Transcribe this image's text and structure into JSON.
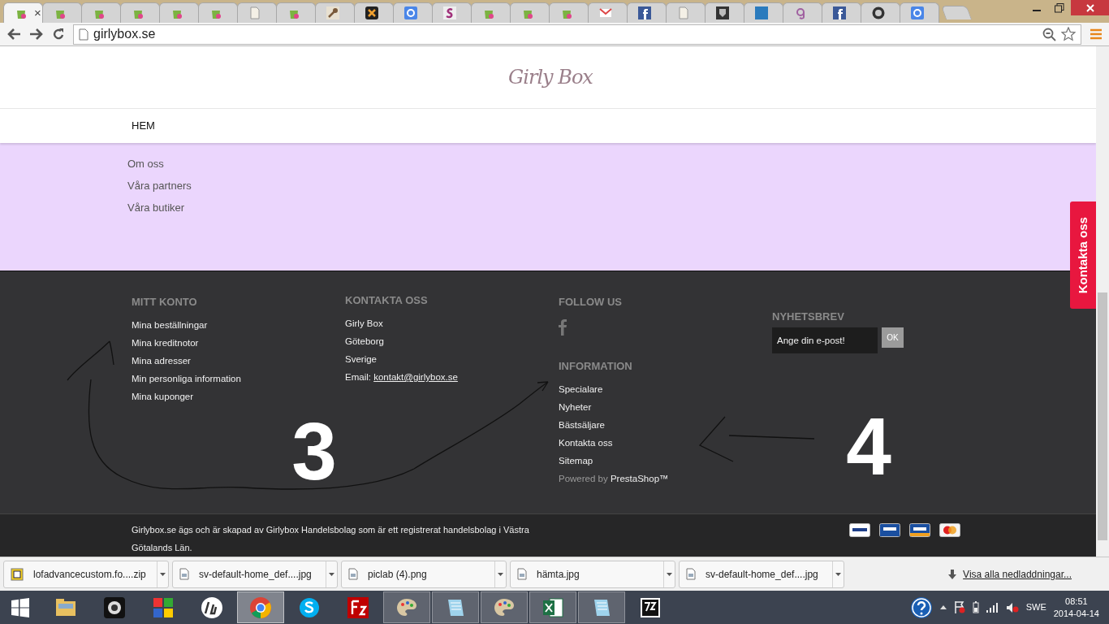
{
  "browser": {
    "tabs": [
      {
        "kind": "shop",
        "selected": true,
        "close": "×"
      },
      {
        "kind": "shop",
        "selected": false
      },
      {
        "kind": "shop",
        "selected": false
      },
      {
        "kind": "shop",
        "selected": false
      },
      {
        "kind": "shop",
        "selected": false
      },
      {
        "kind": "shop",
        "selected": false
      },
      {
        "kind": "page",
        "selected": false
      },
      {
        "kind": "shop",
        "selected": false
      },
      {
        "kind": "wrench",
        "selected": false
      },
      {
        "kind": "joomla",
        "selected": false
      },
      {
        "kind": "google",
        "selected": false
      },
      {
        "kind": "s",
        "selected": false
      },
      {
        "kind": "shop",
        "selected": false
      },
      {
        "kind": "shop",
        "selected": false
      },
      {
        "kind": "shop",
        "selected": false
      },
      {
        "kind": "mail",
        "selected": false
      },
      {
        "kind": "facebook",
        "selected": false
      },
      {
        "kind": "page",
        "selected": false
      },
      {
        "kind": "shield",
        "selected": false
      },
      {
        "kind": "square",
        "selected": false
      },
      {
        "kind": "g",
        "selected": false
      },
      {
        "kind": "facebook",
        "selected": false
      },
      {
        "kind": "seal",
        "selected": false
      },
      {
        "kind": "google",
        "selected": false
      }
    ],
    "address": "girlybox.se"
  },
  "page": {
    "logo": "Girly Box",
    "nav": [
      {
        "label": "HEM"
      }
    ],
    "info_links": [
      "Om oss",
      "Våra partners",
      "Våra butiker"
    ],
    "side_tab": "Kontakta oss",
    "footer": {
      "account": {
        "heading": "MITT KONTO",
        "links": [
          "Mina beställningar",
          "Mina kreditnotor",
          "Mina adresser",
          "Min personliga information",
          "Mina kuponger"
        ]
      },
      "contact": {
        "heading": "KONTAKTA OSS",
        "lines": [
          "Girly Box",
          "Göteborg",
          "Sverige"
        ],
        "email_label": "Email:",
        "email": "kontakt@girlybox.se"
      },
      "follow": {
        "heading": "FOLLOW US"
      },
      "information": {
        "heading": "INFORMATION",
        "links": [
          "Specialare",
          "Nyheter",
          "Bästsäljare",
          "Kontakta oss",
          "Sitemap"
        ],
        "powered_by": "Powered by",
        "powered_brand": "PrestaShop™"
      },
      "newsletter": {
        "heading": "NYHETSBREV",
        "placeholder": "Ange din e-post!",
        "button": "OK"
      }
    },
    "legal": "Girlybox.se ägs och är skapad av Girlybox Handelsbolag som är ett registrerat handelsbolag i Västra Götalands Län.",
    "payments": [
      {
        "kind": "paypal"
      },
      {
        "kind": "visa"
      },
      {
        "kind": "visa"
      },
      {
        "kind": "mastercard"
      }
    ],
    "annotations": [
      {
        "label": "3"
      },
      {
        "label": "4"
      }
    ]
  },
  "downloads": {
    "items": [
      {
        "name": "lofadvancecustom.fo....zip",
        "kind": "zip"
      },
      {
        "name": "sv-default-home_def....jpg",
        "kind": "file"
      },
      {
        "name": "piclab (4).png",
        "kind": "file"
      },
      {
        "name": "hämta.jpg",
        "kind": "file"
      },
      {
        "name": "sv-default-home_def....jpg",
        "kind": "file"
      }
    ],
    "show_all": "Visa alla nedladdningar..."
  },
  "taskbar": {
    "apps": [
      {
        "kind": "folder",
        "selected": false
      },
      {
        "kind": "camera",
        "selected": false
      },
      {
        "kind": "puzzle",
        "selected": false
      },
      {
        "kind": "hp",
        "selected": false
      },
      {
        "kind": "chrome",
        "selected": true
      },
      {
        "kind": "skype",
        "selected": false
      },
      {
        "kind": "filezilla",
        "selected": false
      },
      {
        "kind": "paint",
        "selected": true
      },
      {
        "kind": "notepad",
        "selected": true
      },
      {
        "kind": "paint",
        "selected": true
      },
      {
        "kind": "excel",
        "selected": true
      },
      {
        "kind": "notepad",
        "selected": true
      },
      {
        "kind": "archive",
        "selected": false
      }
    ],
    "language": "SWE",
    "time": "08:51",
    "date": "2014-04-14"
  }
}
